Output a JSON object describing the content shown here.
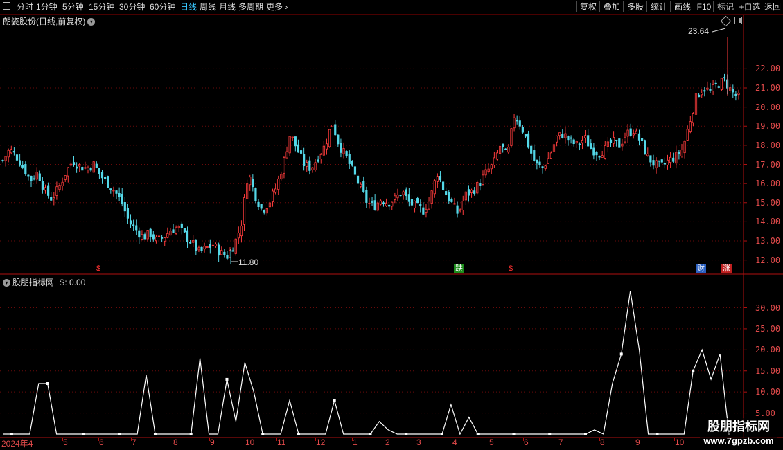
{
  "toolbar": {
    "periods": [
      "分时",
      "1分钟",
      "5分钟",
      "15分钟",
      "30分钟",
      "60分钟",
      "日线",
      "周线",
      "月线",
      "多周期",
      "更多"
    ],
    "active_period": "日线",
    "right_buttons": [
      "复权",
      "叠加",
      "多股",
      "统计",
      "画线",
      "F10",
      "标记",
      "+自选",
      "返回"
    ]
  },
  "price_panel": {
    "title": "朗姿股份(日线,前复权)",
    "high_label": "23.64",
    "low_label": "11.80",
    "y_ticks": [
      "22.00",
      "21.00",
      "20.00",
      "19.00",
      "18.00",
      "17.00",
      "16.00",
      "15.00",
      "14.00",
      "13.00",
      "12.00"
    ],
    "markers": [
      {
        "text": "$",
        "color": "#ff3030",
        "bg": "#000000"
      },
      {
        "text": "跌",
        "color": "#ffffff",
        "bg": "#1a8c1a"
      },
      {
        "text": "$",
        "color": "#ff3030",
        "bg": "#000000"
      },
      {
        "text": "财",
        "color": "#ffffff",
        "bg": "#2a5fc0"
      },
      {
        "text": "涨",
        "color": "#ffffff",
        "bg": "#c02020"
      }
    ]
  },
  "indicator_panel": {
    "title": "股朋指标网",
    "value_label": "S: 0.00",
    "y_ticks": [
      "30.00",
      "25.00",
      "20.00",
      "15.00",
      "10.00",
      "5.00"
    ]
  },
  "x_axis": {
    "labels": [
      "2024年4",
      "5",
      "6",
      "7",
      "8",
      "9",
      "10",
      "11",
      "12",
      "1",
      "2",
      "3",
      "4",
      "5",
      "6",
      "7",
      "8",
      "9",
      "10"
    ]
  },
  "watermark": {
    "title": "股朋指标网",
    "url": "www.7gpzb.com"
  },
  "chart_data": [
    {
      "type": "candlestick",
      "title": "朗姿股份(日线,前复权)",
      "ylim": [
        11.3,
        24.8
      ],
      "annotations": [
        {
          "label": "23.64",
          "type": "high"
        },
        {
          "label": "11.80",
          "type": "low"
        }
      ],
      "close_path": [
        17.2,
        17.8,
        17.4,
        16.8,
        16.2,
        16.6,
        15.6,
        15.2,
        15.8,
        16.6,
        17.2,
        16.9,
        16.8,
        17.0,
        16.4,
        16.0,
        15.6,
        15.0,
        14.0,
        13.6,
        13.2,
        13.4,
        13.0,
        13.2,
        13.6,
        13.7,
        13.3,
        12.9,
        12.4,
        12.6,
        12.8,
        12.4,
        12.2,
        12.8,
        13.8,
        16.6,
        15.4,
        14.6,
        15.0,
        15.8,
        17.0,
        18.6,
        17.8,
        17.0,
        16.8,
        17.4,
        18.0,
        19.2,
        18.0,
        17.4,
        16.6,
        15.8,
        15.0,
        14.8,
        15.2,
        15.0,
        15.2,
        15.6,
        15.0,
        14.8,
        14.6,
        15.2,
        16.6,
        15.6,
        15.0,
        14.4,
        15.4,
        15.6,
        16.0,
        16.6,
        17.0,
        18.0,
        17.4,
        19.6,
        19.0,
        18.0,
        17.0,
        16.8,
        17.4,
        18.4,
        18.6,
        18.2,
        18.0,
        18.4,
        17.8,
        17.6,
        17.8,
        18.2,
        18.0,
        18.6,
        18.8,
        18.2,
        17.4,
        17.0,
        16.9,
        17.2,
        17.4,
        17.8,
        19.2,
        20.6,
        21.0,
        20.8,
        21.2,
        21.4,
        20.8,
        20.5
      ],
      "y_ticks": [
        22,
        21,
        20,
        19,
        18,
        17,
        16,
        15,
        14,
        13,
        12
      ]
    },
    {
      "type": "line",
      "title": "股朋指标网",
      "series": [
        {
          "name": "S",
          "values": [
            0,
            0,
            0,
            0,
            12,
            12,
            0,
            0,
            0,
            0,
            0,
            0,
            0,
            0,
            0,
            0,
            14,
            0,
            0,
            0,
            0,
            0,
            18,
            0,
            0,
            13,
            3,
            17,
            10,
            0,
            0,
            0,
            8,
            0,
            0,
            0,
            0,
            8,
            0,
            0,
            0,
            0,
            3,
            1,
            0,
            0,
            0,
            0,
            0,
            0,
            7,
            0,
            4,
            0,
            0,
            0,
            0,
            0,
            0,
            0,
            0,
            0,
            0,
            0,
            0,
            0,
            1,
            0,
            12,
            19,
            34,
            20,
            0,
            0,
            0,
            0,
            0,
            15,
            20,
            13,
            19,
            0
          ]
        }
      ],
      "ylim": [
        0,
        36
      ],
      "y_ticks": [
        30,
        25,
        20,
        15,
        10,
        5
      ],
      "current_value": "S: 0.00"
    }
  ]
}
